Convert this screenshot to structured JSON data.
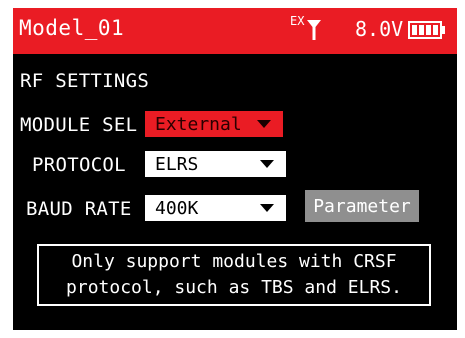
{
  "header": {
    "model_name": "Model_01",
    "module_indicator": "EX",
    "antenna_icon": "antenna-icon",
    "voltage": "8.0V",
    "battery_icon": "battery-icon"
  },
  "rf_settings": {
    "title": "RF SETTINGS",
    "module_sel": {
      "label": "MODULE SEL",
      "value": "External"
    },
    "protocol": {
      "label": "PROTOCOL",
      "value": "ELRS"
    },
    "baud_rate": {
      "label": "BAUD RATE",
      "value": "400K"
    },
    "parameter_button": "Parameter"
  },
  "info": {
    "line1": "Only support modules with CRSF",
    "line2": "protocol, such as TBS and ELRS."
  },
  "colors": {
    "accent_red": "#ea1c24",
    "background": "#000000",
    "button_gray": "#8f8f8f"
  }
}
